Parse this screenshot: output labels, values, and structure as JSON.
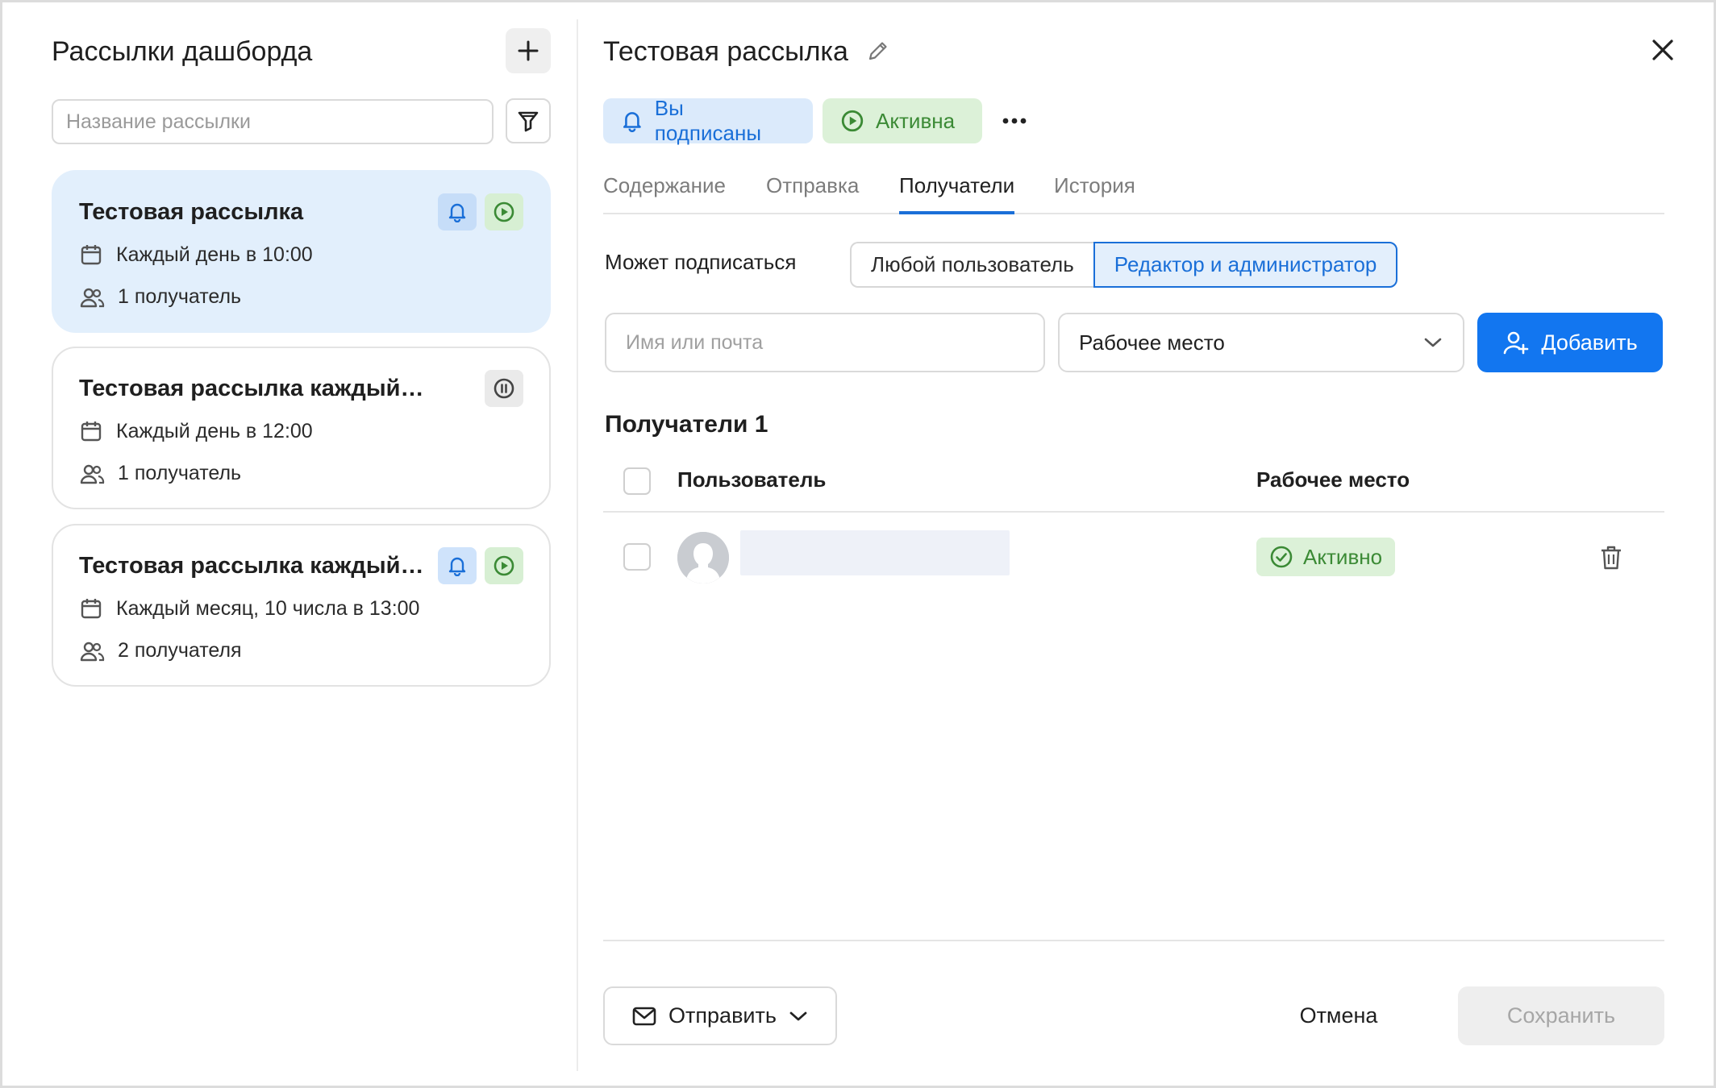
{
  "sidebar": {
    "title": "Рассылки дашборда",
    "add_icon": "plus-icon",
    "filter_icon": "filter-icon",
    "search": {
      "placeholder": "Название рассылки",
      "value": ""
    },
    "mailings": [
      {
        "title": "Тестовая рассылка",
        "schedule": "Каждый день в 10:00",
        "recipients": "1 получатель",
        "subscribed": true,
        "state": "active",
        "selected": true
      },
      {
        "title": "Тестовая рассылка каждый день",
        "schedule": "Каждый день в 12:00",
        "recipients": "1 получатель",
        "subscribed": false,
        "state": "paused",
        "selected": false
      },
      {
        "title": "Тестовая рассылка каждый м...",
        "schedule": "Каждый месяц, 10 числа в 13:00",
        "recipients": "2 получателя",
        "subscribed": true,
        "state": "active",
        "selected": false
      }
    ]
  },
  "detail": {
    "title": "Тестовая рассылка",
    "subscribed_label": "Вы подписаны",
    "status_label": "Активна",
    "tabs": [
      {
        "label": "Содержание",
        "selected": false
      },
      {
        "label": "Отправка",
        "selected": false
      },
      {
        "label": "Получатели",
        "selected": true
      },
      {
        "label": "История",
        "selected": false
      }
    ],
    "who_can_subscribe": {
      "label": "Может подписаться",
      "options": [
        "Любой пользователь",
        "Редактор и администратор"
      ],
      "selected": "Редактор и администратор"
    },
    "add_form": {
      "name_placeholder": "Имя или почта",
      "name_value": "",
      "workspace_value": "Рабочее место",
      "add_label": "Добавить"
    },
    "recipients": {
      "heading": "Получатели 1",
      "columns": [
        "Пользователь",
        "Рабочее место"
      ],
      "rows": [
        {
          "user": "",
          "workspace_status": "Активно"
        }
      ]
    },
    "footer": {
      "send_label": "Отправить",
      "cancel_label": "Отмена",
      "save_label": "Сохранить"
    }
  },
  "colors": {
    "accent": "#1276f0",
    "selected_card_bg": "#e2effc",
    "active_green": "#3b8a35",
    "active_green_bg": "#dcf1d8"
  }
}
